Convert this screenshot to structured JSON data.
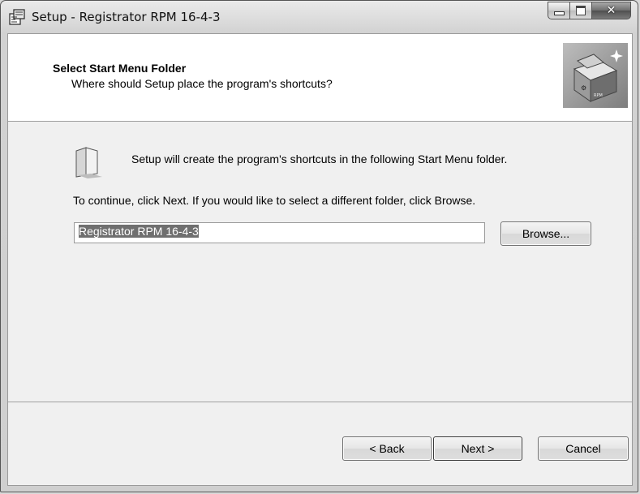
{
  "window": {
    "title": "Setup - Registrator RPM 16-4-3"
  },
  "header": {
    "title": "Select Start Menu Folder",
    "subtitle": "Where should Setup place the program's shortcuts?",
    "image_icon": "installer-box-image"
  },
  "body": {
    "info_text": "Setup will create the program's shortcuts in the following Start Menu folder.",
    "continue_text": "To continue, click Next. If you would like to select a different folder, click Browse.",
    "folder_value": "Registrator RPM 16-4-3",
    "browse_label": "Browse..."
  },
  "footer": {
    "back_label": "< Back",
    "next_label": "Next >",
    "cancel_label": "Cancel"
  },
  "icons": {
    "app": "setup-icon",
    "folder": "start-menu-folder-icon",
    "minimize": "minimize-icon",
    "maximize": "maximize-icon",
    "close": "close-icon"
  }
}
